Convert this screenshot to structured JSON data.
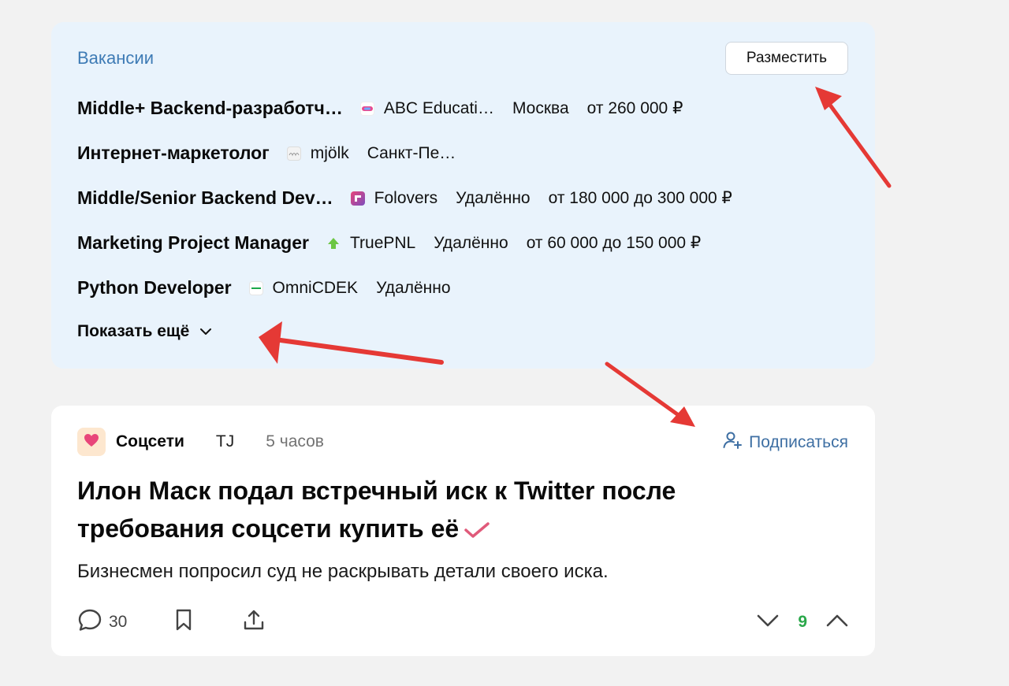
{
  "vacancies": {
    "title": "Вакансии",
    "post_button": "Разместить",
    "items": [
      {
        "name": "Middle+ Backend-разработч…",
        "company": "ABC Educati…",
        "city": "Москва",
        "salary": "от 260 000 ₽",
        "logo_color": "#e84a8f"
      },
      {
        "name": "Интернет-маркетолог",
        "company": "mjölk",
        "city": "Санкт-Пе…",
        "salary": "",
        "logo_color": "#cccccc"
      },
      {
        "name": "Middle/Senior Backend Dev…",
        "company": "Folovers",
        "city": "Удалённо",
        "salary": "от 180 000 до 300 000 ₽",
        "logo_color": "#7c4dbd"
      },
      {
        "name": "Marketing Project Manager",
        "company": "TruePNL",
        "city": "Удалённо",
        "salary": "от 60 000 до 150 000 ₽",
        "logo_color": "#6cc644"
      },
      {
        "name": "Python Developer",
        "company": "OmniCDEK",
        "city": "Удалённо",
        "salary": "",
        "logo_color": "#1aa84a"
      }
    ],
    "show_more": "Показать ещё"
  },
  "post": {
    "subsite": "Соцсети",
    "author": "TJ",
    "time": "5 часов",
    "subscribe": "Подписаться",
    "title": "Илон Маск подал встречный иск к Twitter после требования соцсети купить её",
    "lead": "Бизнесмен попросил суд не раскрывать детали своего иска.",
    "comments": "30",
    "votes": "9"
  },
  "colors": {
    "accent": "#3e7bb5",
    "card_bg": "#e9f3fc",
    "vote_positive": "#2aa84a",
    "annotation": "#e53935"
  },
  "icons": [
    "chevron-down-icon",
    "heart-icon",
    "add-user-icon",
    "check-icon",
    "comment-icon",
    "bookmark-icon",
    "share-icon",
    "downvote-icon",
    "upvote-icon"
  ]
}
